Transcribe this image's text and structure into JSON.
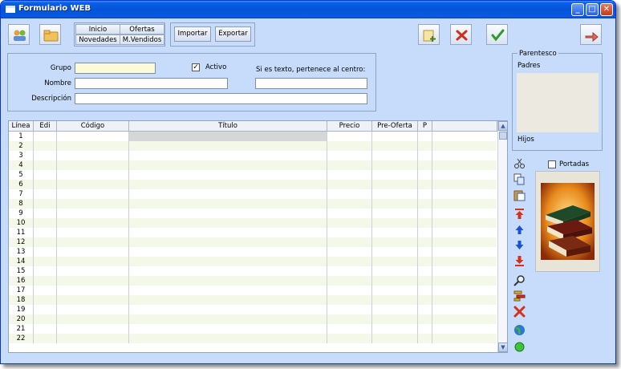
{
  "window": {
    "title": "Formulario WEB"
  },
  "nav": {
    "inicio": "Inicio",
    "ofertas": "Ofertas",
    "novedades": "Novedades",
    "mvendidos": "M.Vendidos"
  },
  "actions": {
    "importar": "Importar",
    "exportar": "Exportar"
  },
  "form": {
    "grupo_label": "Grupo",
    "grupo_value": "",
    "activo_label": "Activo",
    "activo_checked": true,
    "texto_label": "Si es texto, pertenece al centro:",
    "texto_value": "",
    "nombre_label": "Nombre",
    "nombre_value": "",
    "descripcion_label": "Descripción",
    "descripcion_value": ""
  },
  "parentesco": {
    "title": "Parentesco",
    "padres": "Padres",
    "hijos": "Hijos"
  },
  "portadas": {
    "label": "Portadas",
    "checked": false
  },
  "table": {
    "columns": [
      "Línea",
      "Edi",
      "Código",
      "Título",
      "Precio",
      "Pre-Oferta",
      "P"
    ],
    "rows": [
      "1",
      "2",
      "3",
      "4",
      "5",
      "6",
      "7",
      "8",
      "9",
      "10",
      "11",
      "12",
      "13",
      "14",
      "15",
      "16",
      "17",
      "18",
      "19",
      "20",
      "21",
      "22"
    ]
  },
  "toolbar_icons": [
    "people-icon",
    "folder-icon",
    "new-document-icon",
    "delete-icon",
    "accept-icon",
    "exit-icon"
  ],
  "side_icons": [
    "cut-icon",
    "copy-icon",
    "paste-icon",
    "move-first-icon",
    "move-up-icon",
    "move-down-icon",
    "move-last-icon",
    "search-icon",
    "edit-icon",
    "delete-icon",
    "globe-icon",
    "green-dot-icon"
  ],
  "colors": {
    "window_bg": "#c6dcfa",
    "titlebar": "#0453dc",
    "grupo_field": "#fafbd8",
    "row_alt": "#f4f8e8"
  }
}
